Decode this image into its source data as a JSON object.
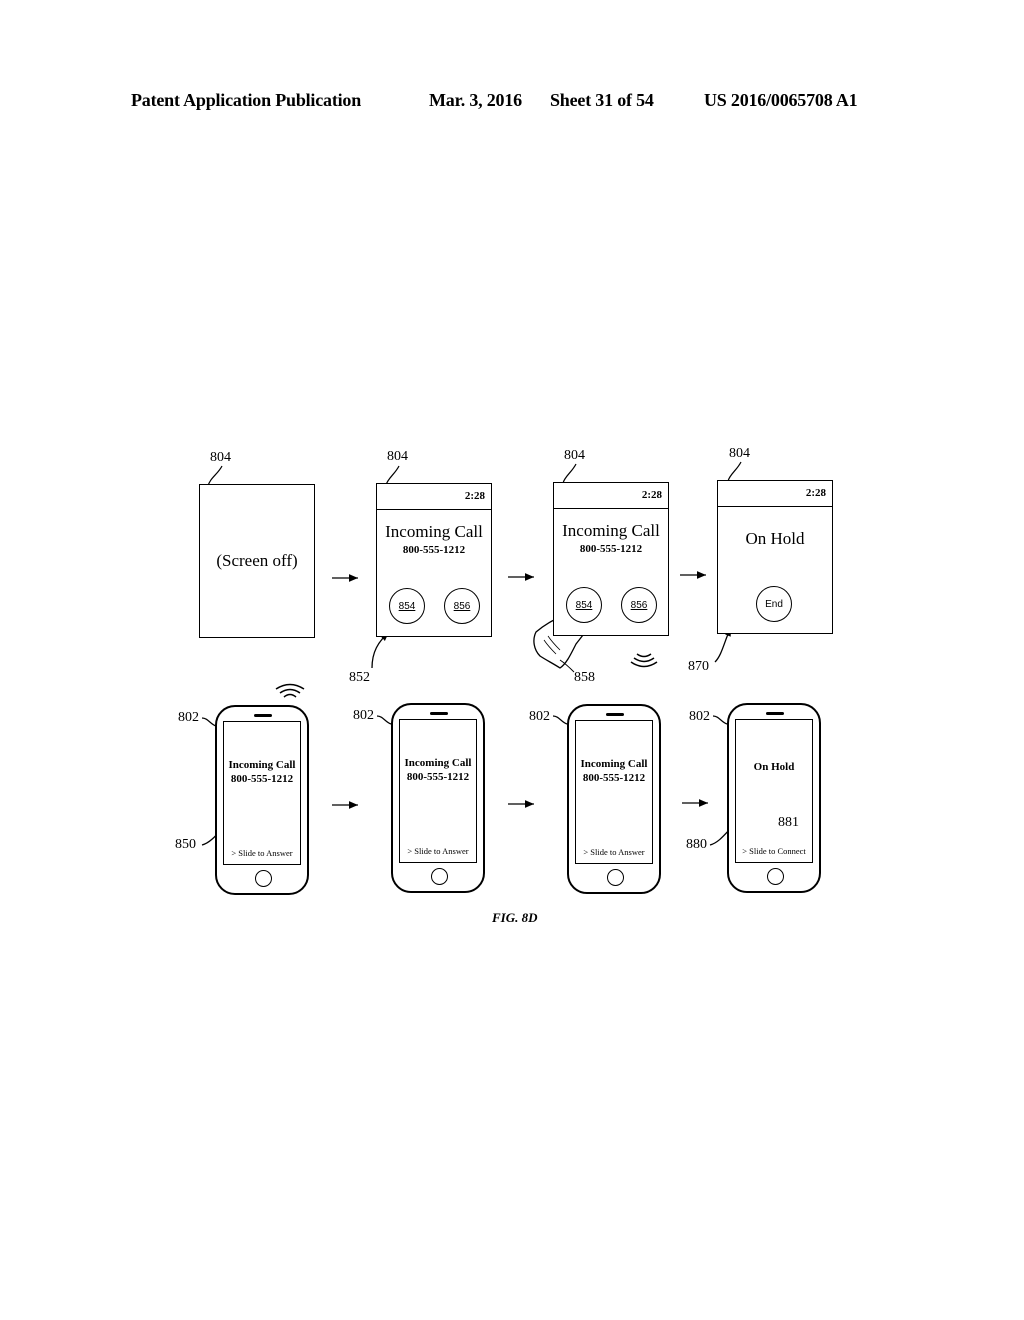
{
  "header": {
    "left": "Patent Application Publication",
    "date": "Mar. 3, 2016",
    "sheet": "Sheet 31 of 54",
    "pub_number": "US 2016/0065708 A1"
  },
  "watch_screens": [
    {
      "ref": "804",
      "content": "(Screen off)"
    },
    {
      "ref": "804",
      "time": "2:28",
      "title": "Incoming Call",
      "number": "800-555-1212",
      "buttons": [
        "854",
        "856"
      ],
      "pointer_ref": "852"
    },
    {
      "ref": "804",
      "time": "2:28",
      "title": "Incoming Call",
      "number": "800-555-1212",
      "buttons": [
        "854",
        "856"
      ],
      "pointer_ref": "858",
      "icons": [
        "finger-icon",
        "haptic-vibration-icon"
      ]
    },
    {
      "ref": "804",
      "time": "2:28",
      "title": "On Hold",
      "button": "End",
      "pointer_ref": "870"
    }
  ],
  "phone_screens": [
    {
      "ref": "802",
      "title": "Incoming Call",
      "number": "800-555-1212",
      "slide": "> Slide to Answer",
      "pointer_ref": "850",
      "icons": [
        "wireless-signal-icon"
      ]
    },
    {
      "ref": "802",
      "title": "Incoming Call",
      "number": "800-555-1212",
      "slide": "> Slide to Answer"
    },
    {
      "ref": "802",
      "title": "Incoming Call",
      "number": "800-555-1212",
      "slide": "> Slide to Answer"
    },
    {
      "ref": "802",
      "title": "On Hold",
      "slide": "> Slide to Connect",
      "pointer_ref": "880",
      "slide_ref": "881"
    }
  ],
  "caption": "FIG. 8D"
}
